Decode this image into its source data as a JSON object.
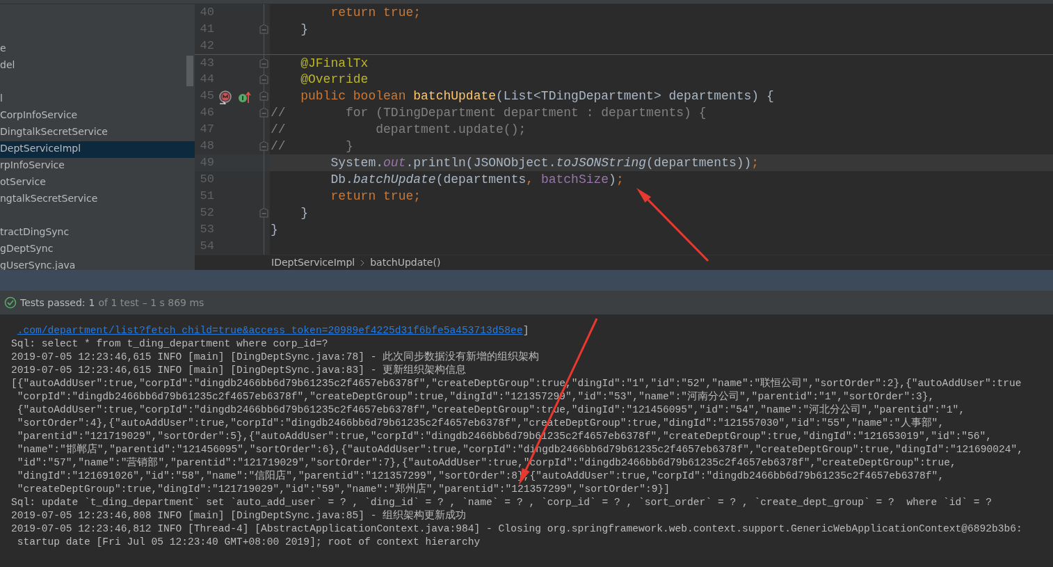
{
  "project_tree": {
    "items": [
      {
        "kind": "spacer"
      },
      {
        "kind": "spacer"
      },
      {
        "kind": "item",
        "text": "e",
        "selected": false
      },
      {
        "kind": "item",
        "text": "del",
        "selected": false
      },
      {
        "kind": "spacer"
      },
      {
        "kind": "item",
        "text": "l",
        "selected": false
      },
      {
        "kind": "item",
        "text": "CorpInfoService",
        "selected": false
      },
      {
        "kind": "item",
        "text": "DingtalkSecretService",
        "selected": false
      },
      {
        "kind": "item",
        "text": "DeptServiceImpl",
        "selected": true
      },
      {
        "kind": "item",
        "text": "rpInfoService",
        "selected": false
      },
      {
        "kind": "item",
        "text": "otService",
        "selected": false
      },
      {
        "kind": "item",
        "text": "ngtalkSecretService",
        "selected": false
      },
      {
        "kind": "spacer"
      },
      {
        "kind": "item",
        "text": "tractDingSync",
        "selected": false
      },
      {
        "kind": "item",
        "text": "gDeptSync",
        "selected": false
      },
      {
        "kind": "item",
        "text": "gUserSync.java",
        "selected": false
      }
    ]
  },
  "editor": {
    "lines": [
      {
        "number": "40",
        "fold": false,
        "current": false,
        "tokens": [
          {
            "text": "        return true;",
            "kind": "keyword"
          }
        ]
      },
      {
        "number": "41",
        "fold": true,
        "current": false,
        "tokens": [
          {
            "text": "    }",
            "kind": "plain"
          }
        ]
      },
      {
        "number": "42",
        "fold": false,
        "current": false
      },
      {
        "number": "43",
        "fold": true,
        "current": false,
        "separator": true,
        "tokens": [
          {
            "text": "    @JFinalTx",
            "kind": "annotation"
          }
        ]
      },
      {
        "number": "44",
        "fold": true,
        "current": false,
        "tokens": [
          {
            "text": "    @Override",
            "kind": "annotation"
          }
        ]
      },
      {
        "number": "45",
        "fold": true,
        "current": false,
        "overrides": true,
        "implements": true,
        "tokens": [
          {
            "text": "    public boolean ",
            "kind": "keyword"
          },
          {
            "text": "batchUpdate",
            "kind": "method"
          },
          {
            "text": "(List<TDingDepartment> departments) {",
            "kind": "plain"
          }
        ]
      },
      {
        "number": "46",
        "fold": true,
        "current": false,
        "tokens": [
          {
            "text": "//        for (TDingDepartment department : departments) {",
            "kind": "comment"
          }
        ]
      },
      {
        "number": "47",
        "fold": false,
        "current": false,
        "tokens": [
          {
            "text": "//            department.update();",
            "kind": "comment"
          }
        ]
      },
      {
        "number": "48",
        "fold": true,
        "current": false,
        "tokens": [
          {
            "text": "//        }",
            "kind": "comment"
          }
        ]
      },
      {
        "number": "49",
        "fold": false,
        "current": true,
        "tokens": [
          {
            "text": "        System.",
            "kind": "plain"
          },
          {
            "text": "out",
            "kind": "static_field"
          },
          {
            "text": ".println(JSONObject.",
            "kind": "plain"
          },
          {
            "text": "toJSONString",
            "kind": "static_method"
          },
          {
            "text": "(departments))",
            "kind": "plain"
          },
          {
            "text": ";",
            "kind": "keyword"
          }
        ]
      },
      {
        "number": "50",
        "fold": false,
        "current": false,
        "tokens": [
          {
            "text": "        Db.",
            "kind": "plain"
          },
          {
            "text": "batchUpdate",
            "kind": "static_method"
          },
          {
            "text": "(departments",
            "kind": "plain"
          },
          {
            "text": ", ",
            "kind": "keyword"
          },
          {
            "text": "batchSize",
            "kind": "field"
          },
          {
            "text": ")",
            "kind": "plain"
          },
          {
            "text": ";",
            "kind": "keyword"
          }
        ]
      },
      {
        "number": "51",
        "fold": false,
        "current": false,
        "tokens": [
          {
            "text": "        return true;",
            "kind": "keyword"
          }
        ]
      },
      {
        "number": "52",
        "fold": true,
        "current": false,
        "tokens": [
          {
            "text": "    }",
            "kind": "plain"
          }
        ]
      },
      {
        "number": "53",
        "fold": false,
        "current": false,
        "tokens": [
          {
            "text": "}",
            "kind": "plain"
          }
        ]
      },
      {
        "number": "54",
        "fold": false,
        "current": false
      }
    ],
    "breadcrumb": [
      "IDeptServiceImpl",
      "batchUpdate()"
    ]
  },
  "test_status": {
    "label": "Tests passed:",
    "passed": "1",
    "total": "of 1 test",
    "duration": "– 1 s 869 ms"
  },
  "console": {
    "lines": [
      {
        "link": ".com/department/list?fetch_child=true&access_token=20989ef4225d31f6bfe5a453713d58ee",
        "text": "]"
      },
      {
        "text": "Sql: select * from t_ding_department where corp_id=?"
      },
      {
        "text": "2019-07-05 12:23:46,615 INFO [main] [DingDeptSync.java:78] - 此次同步数据没有新增的组织架构"
      },
      {
        "text": "2019-07-05 12:23:46,615 INFO [main] [DingDeptSync.java:83] - 更新组织架构信息"
      },
      {
        "text": "[{\"autoAddUser\":true,\"corpId\":\"dingdb2466bb6d79b61235c2f4657eb6378f\",\"createDeptGroup\":true,\"dingId\":\"1\",\"id\":\"52\",\"name\":\"联恒公司\",\"sortOrder\":2},{\"autoAddUser\":true"
      },
      {
        "text": " \"corpId\":\"dingdb2466bb6d79b61235c2f4657eb6378f\",\"createDeptGroup\":true,\"dingId\":\"121357299\",\"id\":\"53\",\"name\":\"河南分公司\",\"parentid\":\"1\",\"sortOrder\":3},"
      },
      {
        "text": " {\"autoAddUser\":true,\"corpId\":\"dingdb2466bb6d79b61235c2f4657eb6378f\",\"createDeptGroup\":true,\"dingId\":\"121456095\",\"id\":\"54\",\"name\":\"河北分公司\",\"parentid\":\"1\","
      },
      {
        "text": " \"sortOrder\":4},{\"autoAddUser\":true,\"corpId\":\"dingdb2466bb6d79b61235c2f4657eb6378f\",\"createDeptGroup\":true,\"dingId\":\"121557030\",\"id\":\"55\",\"name\":\"人事部\","
      },
      {
        "text": " \"parentid\":\"121719029\",\"sortOrder\":5},{\"autoAddUser\":true,\"corpId\":\"dingdb2466bb6d79b61235c2f4657eb6378f\",\"createDeptGroup\":true,\"dingId\":\"121653019\",\"id\":\"56\","
      },
      {
        "text": " \"name\":\"邯郸店\",\"parentid\":\"121456095\",\"sortOrder\":6},{\"autoAddUser\":true,\"corpId\":\"dingdb2466bb6d79b61235c2f4657eb6378f\",\"createDeptGroup\":true,\"dingId\":\"121690024\","
      },
      {
        "text": " \"id\":\"57\",\"name\":\"营销部\",\"parentid\":\"121719029\",\"sortOrder\":7},{\"autoAddUser\":true,\"corpId\":\"dingdb2466bb6d79b61235c2f4657eb6378f\",\"createDeptGroup\":true,"
      },
      {
        "text": " \"dingId\":\"121691026\",\"id\":\"58\",\"name\":\"信阳店\",\"parentid\":\"121357299\",\"sortOrder\":8},{\"autoAddUser\":true,\"corpId\":\"dingdb2466bb6d79b61235c2f4657eb6378f\","
      },
      {
        "text": " \"createDeptGroup\":true,\"dingId\":\"121719029\",\"id\":\"59\",\"name\":\"郑州店\",\"parentid\":\"121357299\",\"sortOrder\":9}]"
      },
      {
        "text": "Sql: update `t_ding_department` set `auto_add_user` = ? , `ding_id` = ? , `name` = ? , `corp_id` = ? , `sort_order` = ? , `create_dept_group` = ?  where `id` = ?"
      },
      {
        "text": "2019-07-05 12:23:46,808 INFO [main] [DingDeptSync.java:85] - 组织架构更新成功"
      },
      {
        "text": "2019-07-05 12:23:46,812 INFO [Thread-4] [AbstractApplicationContext.java:984] - Closing org.springframework.web.context.support.GenericWebApplicationContext@6892b3b6:"
      },
      {
        "text": " startup date [Fri Jul 05 12:23:40 GMT+08:00 2019]; root of context hierarchy"
      }
    ]
  },
  "annotations": [
    {
      "kind": "arrow"
    },
    {
      "kind": "arrow"
    }
  ]
}
